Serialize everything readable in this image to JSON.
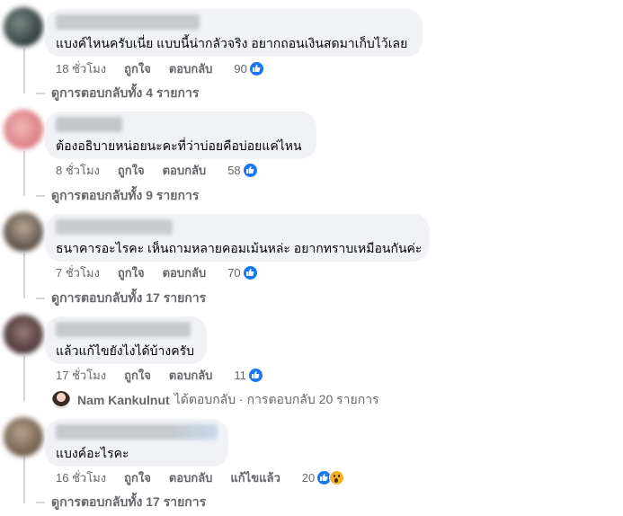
{
  "comments": [
    {
      "text": "แบงค์ไหนครับเนี่ย แบบนี้น่ากลัวจริง อยากถอนเงินสดมาเก็บไว้เลย",
      "time": "18 ชั่วโมง",
      "like_label": "ถูกใจ",
      "reply_label": "ตอบกลับ",
      "reaction_count": "90",
      "replies_link": "ดูการตอบกลับทั้ง 4 รายการ"
    },
    {
      "text": "ต้องอธิบายหน่อยนะคะที่ว่าบ่อยคือบ่อยแค่ไหน",
      "time": "8 ชั่วโมง",
      "like_label": "ถูกใจ",
      "reply_label": "ตอบกลับ",
      "reaction_count": "58",
      "replies_link": "ดูการตอบกลับทั้ง 9 รายการ"
    },
    {
      "text": "ธนาคารอะไรคะ เห็นถามหลายคอมเม้นหล่ะ อยากทราบเหมือนกันค่ะ",
      "time": "7 ชั่วโมง",
      "like_label": "ถูกใจ",
      "reply_label": "ตอบกลับ",
      "reaction_count": "70",
      "replies_link": "ดูการตอบกลับทั้ง 17 รายการ"
    },
    {
      "text": "แล้วแก้ไขยังไงได้บ้างครับ",
      "time": "17 ชั่วโมง",
      "like_label": "ถูกใจ",
      "reply_label": "ตอบกลับ",
      "reaction_count": "11",
      "reply_preview": {
        "name": "Nam Kankulnut",
        "text": "ได้ตอบกลับ · การตอบกลับ 20 รายการ"
      }
    },
    {
      "text": "แบงค์อะไรคะ",
      "time": "16 ชั่วโมง",
      "like_label": "ถูกใจ",
      "reply_label": "ตอบกลับ",
      "edited_label": "แก้ไขแล้ว",
      "reaction_count": "20",
      "replies_link": "ดูการตอบกลับทั้ง 17 รายการ"
    }
  ],
  "icons": {
    "like": "like-reaction-icon",
    "wow": "wow-reaction-icon"
  },
  "colors": {
    "bubble": "#f0f2f5",
    "meta_text": "#65676b",
    "like_blue": "#1877f2",
    "wow_yellow": "#f7b125"
  }
}
